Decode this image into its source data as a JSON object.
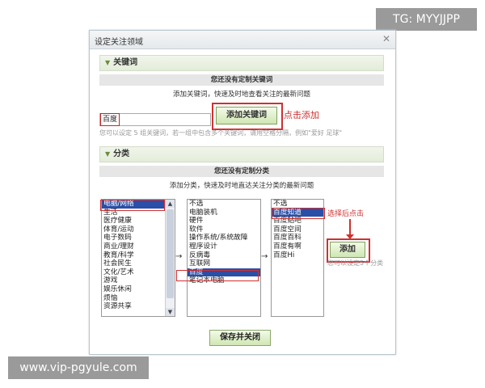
{
  "watermarks": {
    "top_right": "TG: MYYJJPP",
    "bottom_left": "www.vip-pgyule.com"
  },
  "dialog": {
    "title": "设定关注领域",
    "close_icon": "✕"
  },
  "keywords": {
    "section_title": "关键词",
    "empty_text": "您还没有定制关键词",
    "sub_text": "添加关键词，快速及时地查看关注的最新问题",
    "input_value": "百度",
    "add_button": "添加关键词",
    "annotation": "点击添加",
    "hint": "您可以设定 5 组关键词，若一组中包含多个关键词，请用空格分隔，例如\"爱好 足球\""
  },
  "categories": {
    "section_title": "分类",
    "empty_text": "您还没有定制分类",
    "sub_text": "添加分类，快速及时地直达关注分类的最新问题",
    "list1": [
      "电脑/网络",
      "生活",
      "医疗健康",
      "体育/运动",
      "电子数码",
      "商业/理财",
      "教育/科学",
      "社会民生",
      "文化/艺术",
      "游戏",
      "娱乐休闲",
      "烦恼",
      "资源共享"
    ],
    "list1_selected": 0,
    "list2": [
      "不选",
      "电脑装机",
      "硬件",
      "软件",
      "操作系统/系统故障",
      "程序设计",
      "反病毒",
      "互联网",
      "百度",
      "笔记本电脑"
    ],
    "list2_selected": 8,
    "list3": [
      "不选",
      "百度知道",
      "百度贴吧",
      "百度空间",
      "百度百科",
      "百度有啊",
      "百度Hi"
    ],
    "list3_selected": 1,
    "annotation": "选择后点击",
    "add_button": "添加",
    "limit_note": "您可以设定5个分类",
    "arrow_glyph": "→"
  },
  "save_button": "保存并关闭"
}
